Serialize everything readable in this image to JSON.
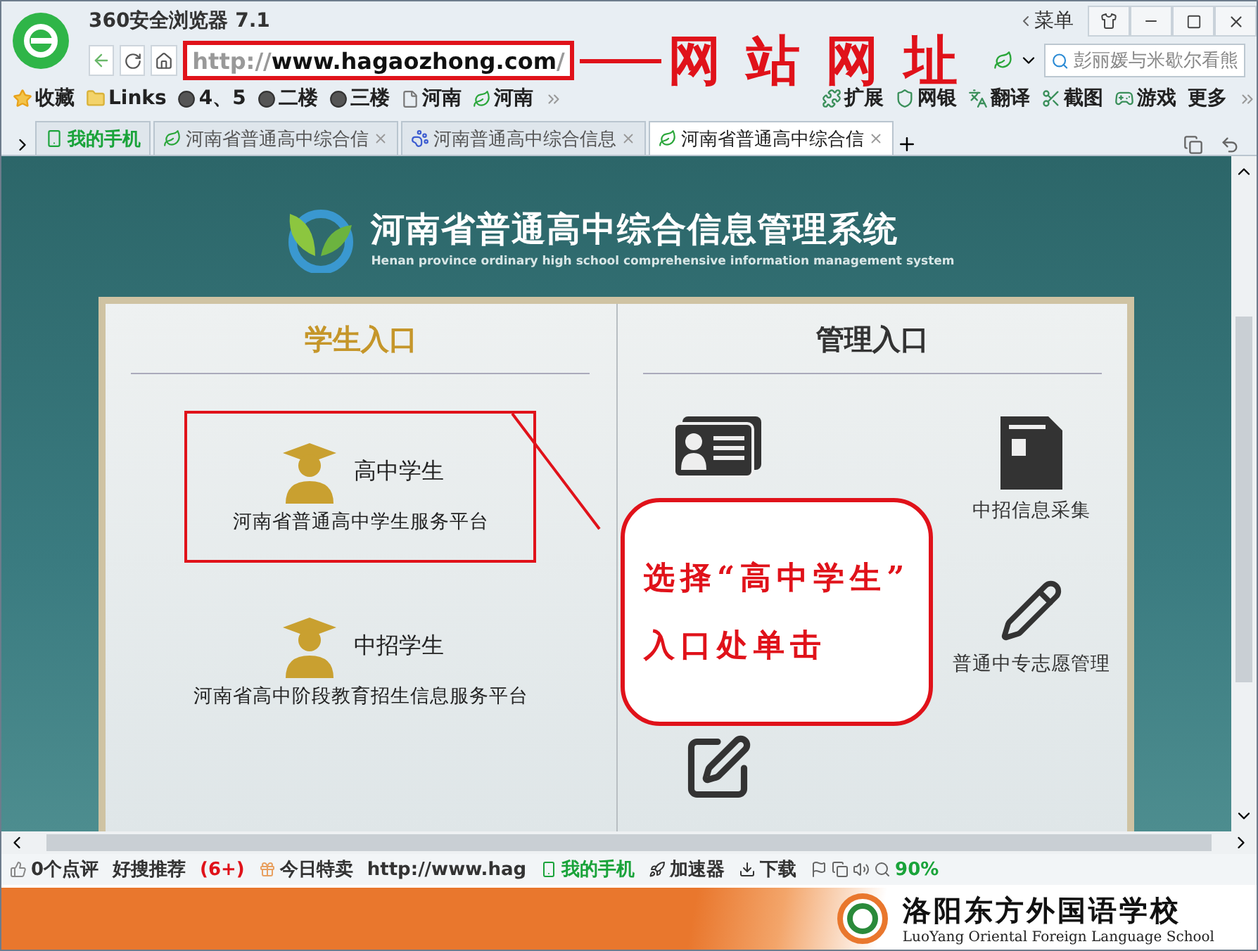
{
  "browser": {
    "title": "360安全浏览器 7.1",
    "menu_label": "菜单",
    "url_prefix": "http://",
    "url_host": "www.hagaozhong.com",
    "url_suffix": "/",
    "search_placeholder": "彭丽媛与米歇尔看熊"
  },
  "bookmarks": [
    {
      "label": "收藏",
      "kind": "star"
    },
    {
      "label": "Links",
      "kind": "folder"
    },
    {
      "label": "4、5",
      "kind": "dot"
    },
    {
      "label": "二楼",
      "kind": "dot"
    },
    {
      "label": "三楼",
      "kind": "dot"
    },
    {
      "label": "河南",
      "kind": "page"
    },
    {
      "label": "河南",
      "kind": "leaf"
    }
  ],
  "toolbar_items": [
    {
      "label": "扩展",
      "kind": "puzzle"
    },
    {
      "label": "网银",
      "kind": "shield"
    },
    {
      "label": "翻译",
      "kind": "translate"
    },
    {
      "label": "截图",
      "kind": "scissors"
    },
    {
      "label": "游戏",
      "kind": "game"
    },
    {
      "label": "更多",
      "kind": "more"
    }
  ],
  "tabs": [
    {
      "label": "我的手机",
      "selected": false,
      "kind": "phone"
    },
    {
      "label": "河南省普通高中综合信",
      "selected": false,
      "kind": "leaf"
    },
    {
      "label": "河南普通高中综合信息",
      "selected": false,
      "kind": "paw"
    },
    {
      "label": "河南省普通高中综合信",
      "selected": true,
      "kind": "leaf"
    }
  ],
  "site": {
    "title": "河南省普通高中综合信息管理系统",
    "subtitle": "Henan province ordinary high school comprehensive information management system",
    "student_heading": "学生入口",
    "admin_heading": "管理入口",
    "student_entries": [
      {
        "title": "高中学生",
        "subtitle": "河南省普通高中学生服务平台",
        "highlighted": true
      },
      {
        "title": "中招学生",
        "subtitle": "河南省高中阶段教育招生信息服务平台",
        "highlighted": false
      }
    ],
    "admin_columns": [
      [
        {
          "kind": "id-card"
        },
        {
          "kind": "edit"
        }
      ],
      [
        {
          "kind": "document",
          "label": "中招信息采集"
        },
        {
          "kind": "pencil",
          "label": "普通中专志愿管理"
        }
      ]
    ]
  },
  "annotations": {
    "url_label": "网站网址",
    "callout": [
      "选择“高中学生”",
      "入口处单击"
    ]
  },
  "status_bar": [
    {
      "label": "0个点评",
      "kind": "plain"
    },
    {
      "label": "好搜推荐",
      "kind": "plain"
    },
    {
      "label": "(6+)",
      "kind": "alert"
    },
    {
      "label": "今日特卖",
      "kind": "plain"
    },
    {
      "label": "http://www.hag",
      "kind": "plain"
    },
    {
      "label": "我的手机",
      "kind": "green"
    },
    {
      "label": "加速器",
      "kind": "plain"
    },
    {
      "label": "下载",
      "kind": "plain"
    },
    {
      "label": "90%",
      "kind": "green"
    }
  ],
  "banner": {
    "name": "洛阳东方外国语学校",
    "subtitle": "LuoYang Oriental Foreign Language School"
  }
}
